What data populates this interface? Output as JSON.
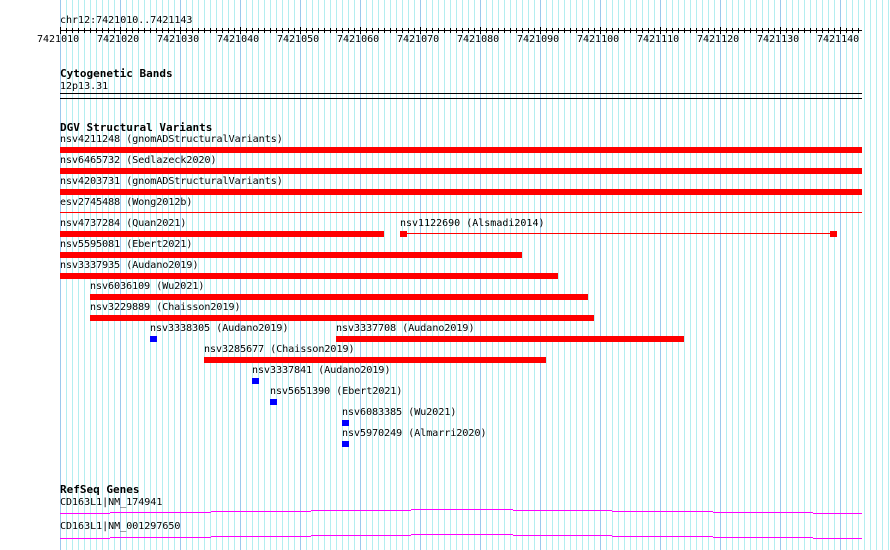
{
  "ruler": {
    "location": "chr12:7421010..7421143",
    "start": 7421010,
    "end": 7421143,
    "tick_labels": [
      "7421010",
      "7421020",
      "7421030",
      "7421040",
      "7421050",
      "7421060",
      "7421070",
      "7421080",
      "7421090",
      "7421100",
      "7421110",
      "7421120",
      "7421130",
      "7421140"
    ]
  },
  "tracks": {
    "cytoband": {
      "title": "Cytogenetic Bands",
      "band": "12p13.31"
    },
    "dgv": {
      "title": "DGV Structural Variants",
      "colors": {
        "red": "#ff0000",
        "blue": "#0000ff"
      },
      "features": [
        {
          "label": "nsv4211248 (gnomADStructuralVariants)",
          "row": 0,
          "start": 7421010,
          "end": 7421144,
          "color": "red",
          "style": "bar"
        },
        {
          "label": "nsv6465732 (Sedlazeck2020)",
          "row": 1,
          "start": 7421010,
          "end": 7421144,
          "color": "red",
          "style": "bar"
        },
        {
          "label": "nsv4203731 (gnomADStructuralVariants)",
          "row": 2,
          "start": 7421010,
          "end": 7421144,
          "color": "red",
          "style": "bar"
        },
        {
          "label": "esv2745488 (Wong2012b)",
          "row": 3,
          "start": 7421010,
          "end": 7421144,
          "color": "red",
          "style": "line"
        },
        {
          "label": "nsv4737284 (Quan2021)",
          "row": 4,
          "start": 7421010,
          "end": 7421064,
          "color": "red",
          "style": "bar"
        },
        {
          "label": "nsv1122690 (Alsmadi2014)",
          "row": 4,
          "start": 7421066.7,
          "end": 7421139.5,
          "color": "red",
          "style": "split"
        },
        {
          "label": "nsv5595081 (Ebert2021)",
          "row": 5,
          "start": 7421010,
          "end": 7421087,
          "color": "red",
          "style": "bar"
        },
        {
          "label": "nsv3337935 (Audano2019)",
          "row": 6,
          "start": 7421010,
          "end": 7421093,
          "color": "red",
          "style": "bar"
        },
        {
          "label": "nsv6036109 (Wu2021)",
          "row": 7,
          "start": 7421015,
          "end": 7421098,
          "color": "red",
          "style": "bar"
        },
        {
          "label": "nsv3229889 (Chaisson2019)",
          "row": 8,
          "start": 7421015,
          "end": 7421099,
          "color": "red",
          "style": "bar"
        },
        {
          "label": "nsv3338305 (Audano2019)",
          "row": 9,
          "start": 7421025,
          "end": 7421026.2,
          "color": "blue",
          "style": "bar"
        },
        {
          "label": "nsv3337708 (Audano2019)",
          "row": 9,
          "start": 7421056,
          "end": 7421114,
          "color": "red",
          "style": "bar"
        },
        {
          "label": "nsv3285677 (Chaisson2019)",
          "row": 10,
          "start": 7421034,
          "end": 7421091,
          "color": "red",
          "style": "bar"
        },
        {
          "label": "nsv3337841 (Audano2019)",
          "row": 11,
          "start": 7421042,
          "end": 7421043.2,
          "color": "blue",
          "style": "bar"
        },
        {
          "label": "nsv5651390 (Ebert2021)",
          "row": 12,
          "start": 7421045,
          "end": 7421046.2,
          "color": "blue",
          "style": "bar"
        },
        {
          "label": "nsv6083385 (Wu2021)",
          "row": 13,
          "start": 7421057,
          "end": 7421058.2,
          "color": "blue",
          "style": "bar"
        },
        {
          "label": "nsv5970249 (Almarri2020)",
          "row": 14,
          "start": 7421057,
          "end": 7421058.2,
          "color": "blue",
          "style": "bar"
        }
      ]
    },
    "refseq": {
      "title": "RefSeq Genes",
      "color": "#ff00ff",
      "genes": [
        {
          "label": "CD163L1|NM_174941"
        },
        {
          "label": "CD163L1|NM_001297650"
        }
      ]
    }
  }
}
